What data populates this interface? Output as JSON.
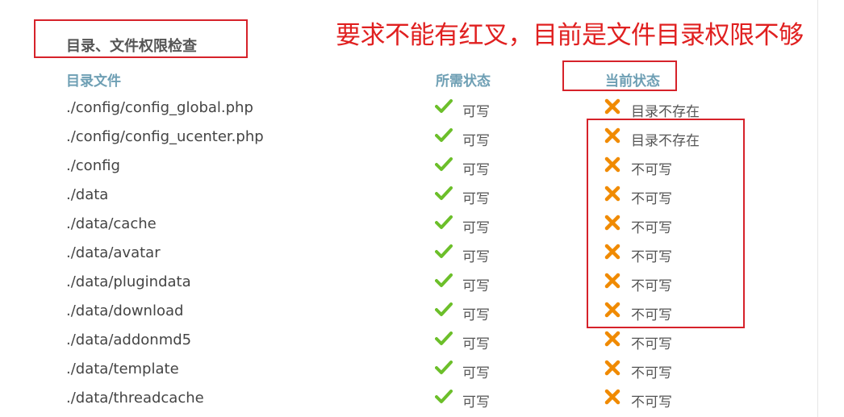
{
  "section_title": "目录、文件权限检查",
  "annotation": "要求不能有红叉，目前是文件目录权限不够",
  "headers": {
    "file": "目录文件",
    "required": "所需状态",
    "current": "当前状态"
  },
  "rows": [
    {
      "path": "./config/config_global.php",
      "required": "可写",
      "current": "目录不存在"
    },
    {
      "path": "./config/config_ucenter.php",
      "required": "可写",
      "current": "目录不存在"
    },
    {
      "path": "./config",
      "required": "可写",
      "current": "不可写"
    },
    {
      "path": "./data",
      "required": "可写",
      "current": "不可写"
    },
    {
      "path": "./data/cache",
      "required": "可写",
      "current": "不可写"
    },
    {
      "path": "./data/avatar",
      "required": "可写",
      "current": "不可写"
    },
    {
      "path": "./data/plugindata",
      "required": "可写",
      "current": "不可写"
    },
    {
      "path": "./data/download",
      "required": "可写",
      "current": "不可写"
    },
    {
      "path": "./data/addonmd5",
      "required": "可写",
      "current": "不可写"
    },
    {
      "path": "./data/template",
      "required": "可写",
      "current": "不可写"
    },
    {
      "path": "./data/threadcache",
      "required": "可写",
      "current": "不可写"
    }
  ],
  "icons": {
    "ok": "check-icon",
    "fail": "cross-icon"
  },
  "colors": {
    "check": "#6cbf2a",
    "cross": "#f08a00",
    "annotation": "#e02020",
    "header": "#6e9fb4"
  }
}
